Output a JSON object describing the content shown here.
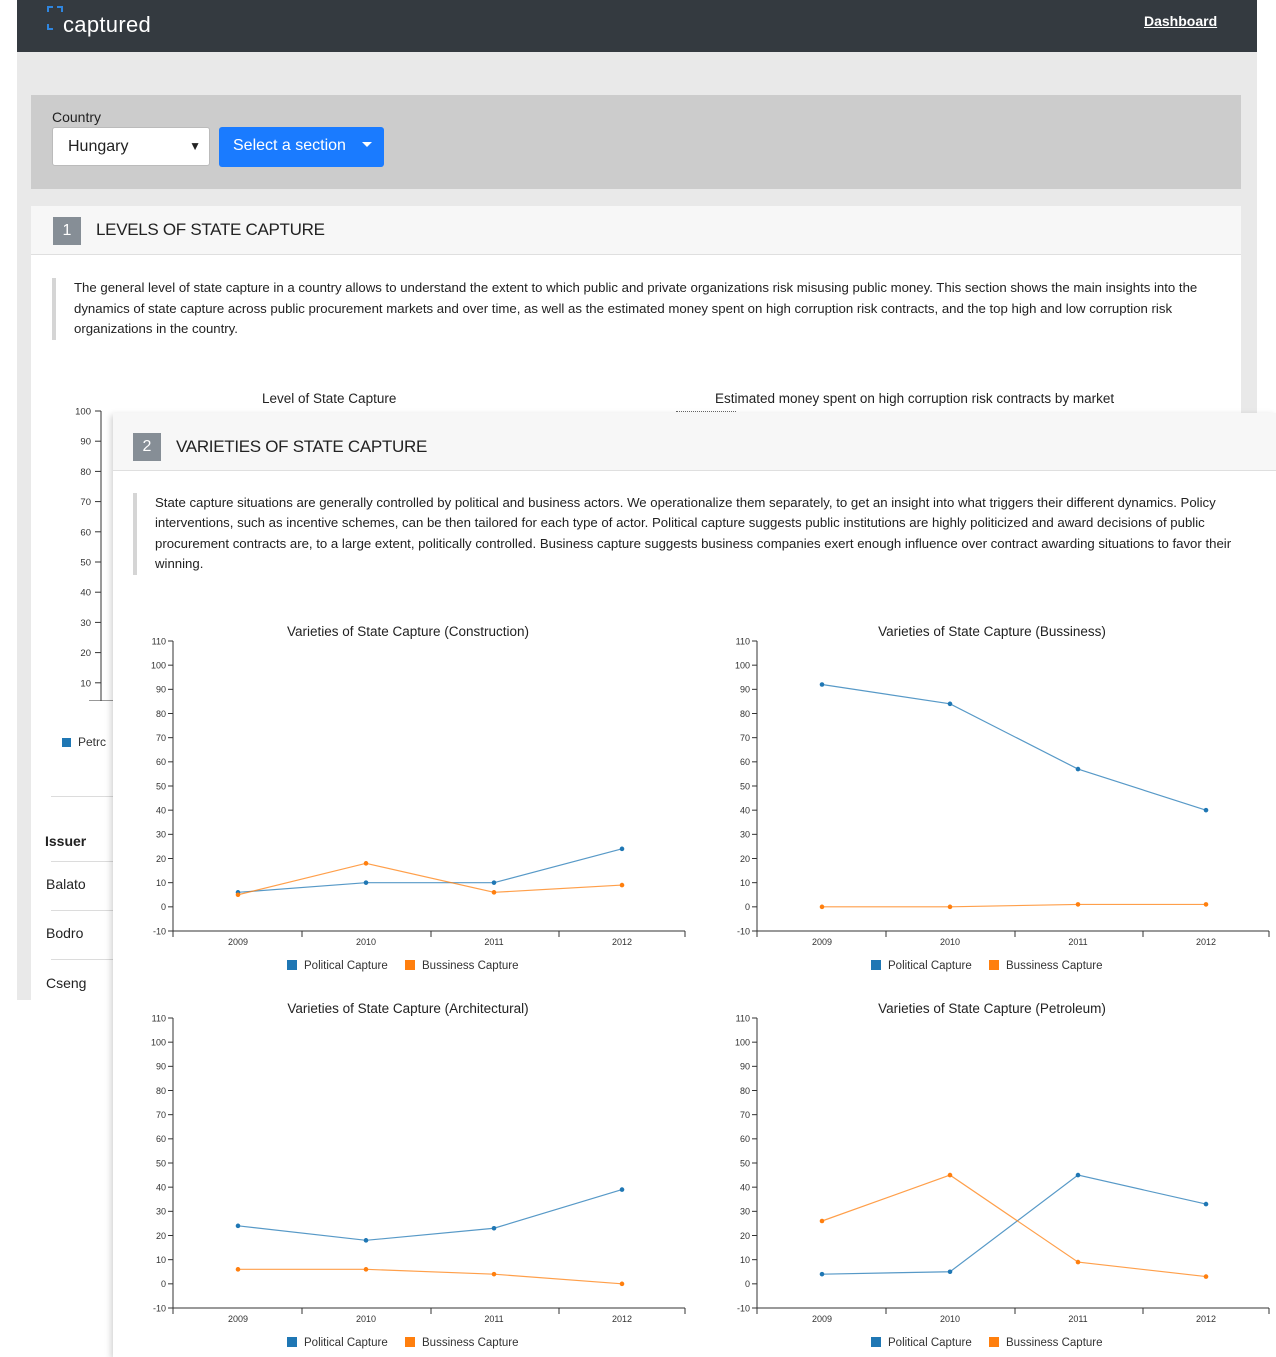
{
  "navbar": {
    "brand": "captured",
    "dashboard_link": "Dashboard"
  },
  "filters": {
    "country_label": "Country",
    "country_value": "Hungary",
    "section_button": "Select a section"
  },
  "section1": {
    "number": "1",
    "title": "LEVELS OF STATE CAPTURE",
    "description": "The general level of state capture in a country allows to understand the extent to which public and private organizations risk misusing public money. This section shows the main insights into the dynamics of state capture across public procurement markets and over time, as well as the estimated money spent on high corruption risk contracts, and the top high and low corruption risk organizations in the country.",
    "chart_left_title": "Level of State Capture",
    "chart_right_title": "Estimated money spent on high corruption risk contracts by market",
    "axis_ticks": [
      "100",
      "90",
      "80",
      "70",
      "60",
      "50",
      "40",
      "30",
      "20",
      "10"
    ],
    "legend_partial": "Petrc",
    "table_header": "Issuer",
    "table_rows": [
      "Balato",
      "Bodro",
      "Cseng"
    ]
  },
  "section2": {
    "number": "2",
    "title": "VARIETIES OF STATE CAPTURE",
    "description": "State capture situations are generally controlled by political and business actors. We operationalize them separately, to get an insight into what triggers their different dynamics. Policy interventions, such as incentive schemes, can be then tailored for each type of actor. Political capture suggests public institutions are highly politicized and award decisions of public procurement contracts are, to a large extent, politically controlled. Business capture suggests business companies exert enough influence over contract awarding situations to favor their winning."
  },
  "colors": {
    "political": "#1f77b4",
    "business": "#ff7f0e",
    "navbar": "#343a40",
    "button": "#1a7bff"
  },
  "chart_data": [
    {
      "type": "line",
      "title": "Varieties of State Capture (Construction)",
      "x": [
        "2009",
        "2010",
        "2011",
        "2012"
      ],
      "ylim": [
        -10,
        110
      ],
      "yticks": [
        -10,
        0,
        10,
        20,
        30,
        40,
        50,
        60,
        70,
        80,
        90,
        100,
        110
      ],
      "series": [
        {
          "name": "Political Capture",
          "values": [
            6,
            10,
            10,
            24
          ]
        },
        {
          "name": "Bussiness Capture",
          "values": [
            5,
            18,
            6,
            9
          ]
        }
      ]
    },
    {
      "type": "line",
      "title": "Varieties of State Capture (Bussiness)",
      "x": [
        "2009",
        "2010",
        "2011",
        "2012"
      ],
      "ylim": [
        -10,
        110
      ],
      "yticks": [
        -10,
        0,
        10,
        20,
        30,
        40,
        50,
        60,
        70,
        80,
        90,
        100,
        110
      ],
      "series": [
        {
          "name": "Political Capture",
          "values": [
            92,
            84,
            57,
            40
          ]
        },
        {
          "name": "Bussiness Capture",
          "values": [
            0,
            0,
            1,
            1
          ]
        }
      ]
    },
    {
      "type": "line",
      "title": "Varieties of State Capture (Architectural)",
      "x": [
        "2009",
        "2010",
        "2011",
        "2012"
      ],
      "ylim": [
        -10,
        110
      ],
      "yticks": [
        -10,
        0,
        10,
        20,
        30,
        40,
        50,
        60,
        70,
        80,
        90,
        100,
        110
      ],
      "series": [
        {
          "name": "Political Capture",
          "values": [
            24,
            18,
            23,
            39
          ]
        },
        {
          "name": "Bussiness Capture",
          "values": [
            6,
            6,
            4,
            0
          ]
        }
      ]
    },
    {
      "type": "line",
      "title": "Varieties of State Capture (Petroleum)",
      "x": [
        "2009",
        "2010",
        "2011",
        "2012"
      ],
      "ylim": [
        -10,
        110
      ],
      "yticks": [
        -10,
        0,
        10,
        20,
        30,
        40,
        50,
        60,
        70,
        80,
        90,
        100,
        110
      ],
      "series": [
        {
          "name": "Political Capture",
          "values": [
            4,
            5,
            45,
            33
          ]
        },
        {
          "name": "Bussiness Capture",
          "values": [
            26,
            45,
            9,
            3
          ]
        }
      ]
    }
  ]
}
